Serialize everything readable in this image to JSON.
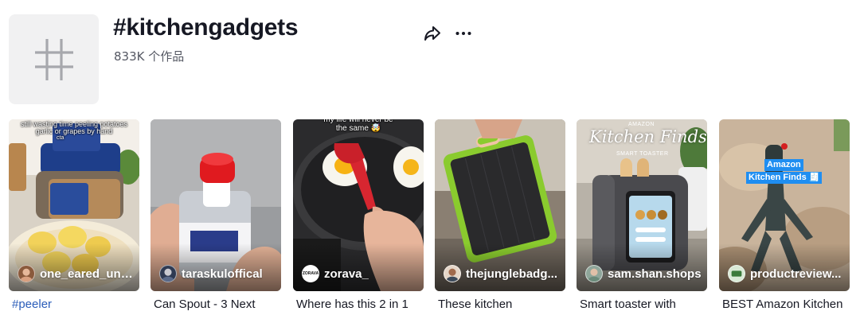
{
  "header": {
    "title": "#kitchengadgets",
    "count": "833K 个作品",
    "icons": {
      "avatar": "hashtag-icon",
      "share": "share-arrow-icon",
      "more": "more-dots-icon"
    }
  },
  "videos": [
    {
      "author": "one_eared_uno6",
      "caption": "#peeler",
      "overlay": "still wasting time peeling potatoes\ngarlic or grapes by hand",
      "sub_overlay": "cta"
    },
    {
      "author": "taraskuloffical",
      "caption": "Can Spout - 3 Next"
    },
    {
      "author": "zorava_",
      "avatar_text": "ZORAVA",
      "caption": "Where has this 2 in 1",
      "overlay": "my life will never be\nthe same 🤯"
    },
    {
      "author": "thejunglebadg...",
      "caption": "These kitchen"
    },
    {
      "author": "sam.shan.shops",
      "caption": "Smart toaster with",
      "small_overlay": "AMAZON",
      "script_overlay": "Kitchen Finds",
      "sub_overlay": "SMART TOASTER"
    },
    {
      "author": "productreview...",
      "caption": "BEST Amazon Kitchen",
      "badge_line1": "Amazon",
      "badge_line2": "Kitchen Finds 🧾"
    }
  ],
  "colors": {
    "link": "#2b5db9",
    "text": "#161823",
    "muted": "#555863",
    "avatar_bg": "#f1f1f2"
  }
}
